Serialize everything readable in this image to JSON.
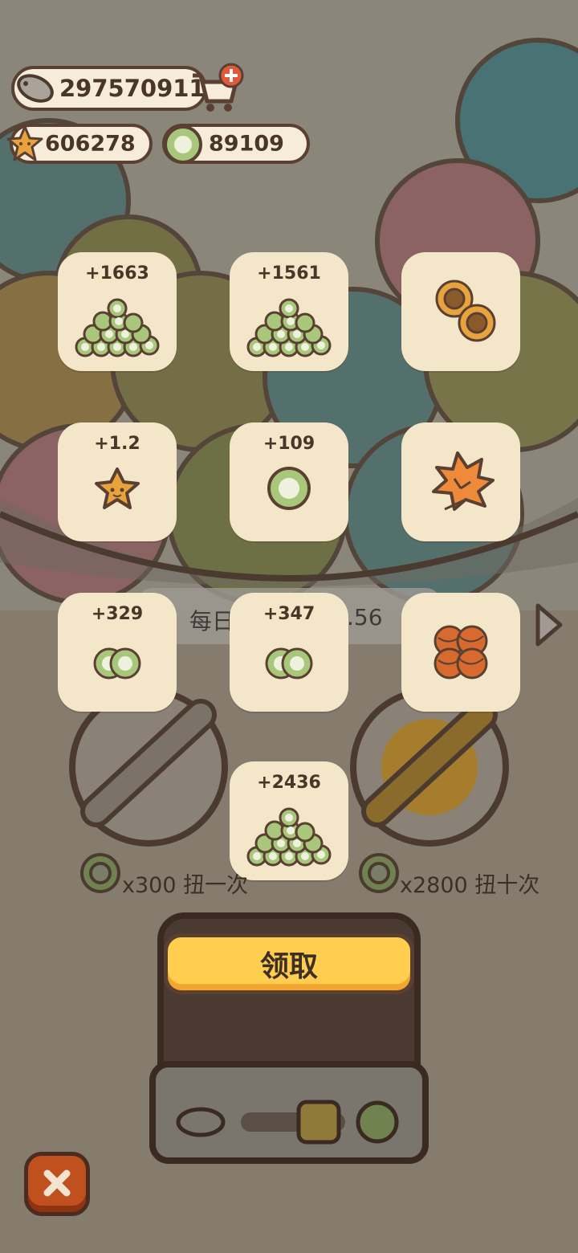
{
  "hud": {
    "fish_count": "297570911",
    "star_count": "606278",
    "coin_count": "89109",
    "icons": [
      "fish-icon",
      "cart-add-icon",
      "star-icon",
      "coin-icon"
    ]
  },
  "banner": {
    "left_text": "每日",
    "right_text": ".56"
  },
  "rewards": [
    {
      "amount": "+1663",
      "icon": "coin-pile-icon"
    },
    {
      "amount": "+1561",
      "icon": "coin-pile-icon"
    },
    {
      "amount": "",
      "icon": "sunflower-icon"
    },
    {
      "amount": "+1.2",
      "icon": "star-icon"
    },
    {
      "amount": "+109",
      "icon": "coin-icon"
    },
    {
      "amount": "",
      "icon": "maple-leaf-icon"
    },
    {
      "amount": "+329",
      "icon": "two-coins-icon"
    },
    {
      "amount": "+347",
      "icon": "two-coins-icon"
    },
    {
      "amount": "",
      "icon": "yarn-balls-icon"
    },
    {
      "amount": "+2436",
      "icon": "coin-pile-icon"
    }
  ],
  "gacha": {
    "single_cost": "x300 扭一次",
    "ten_cost": "x2800 扭十次"
  },
  "claim_label": "领取",
  "colors": {
    "card": "#f4e6c8",
    "outline": "#5a4032",
    "button": "#ffce4f",
    "close": "#c0501e",
    "coin": "#a8c77a"
  }
}
